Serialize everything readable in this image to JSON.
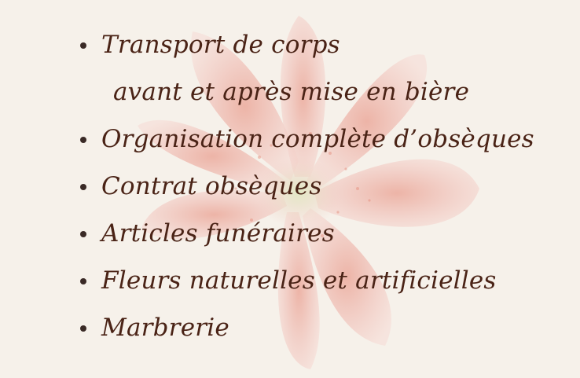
{
  "services": {
    "items": [
      {
        "text": "Transport de corps",
        "bullet": true
      },
      {
        "text": "avant et après mise en bière",
        "bullet": false
      },
      {
        "text": "Organisation complète d’obsèques",
        "bullet": true
      },
      {
        "text": "Contrat obsèques",
        "bullet": true
      },
      {
        "text": "Articles funéraires",
        "bullet": true
      },
      {
        "text": "Fleurs naturelles et artificielles",
        "bullet": true
      },
      {
        "text": "Marbrerie",
        "bullet": true
      }
    ]
  },
  "colors": {
    "background": "#f6f1ea",
    "text": "#4a2316",
    "bullet": "#3a2a26",
    "petal": "#f2cfc8",
    "petal_center": "#e9a89a",
    "stamen": "#c7d69a"
  },
  "decoration": {
    "background_image": "lily-flower-watermark"
  }
}
